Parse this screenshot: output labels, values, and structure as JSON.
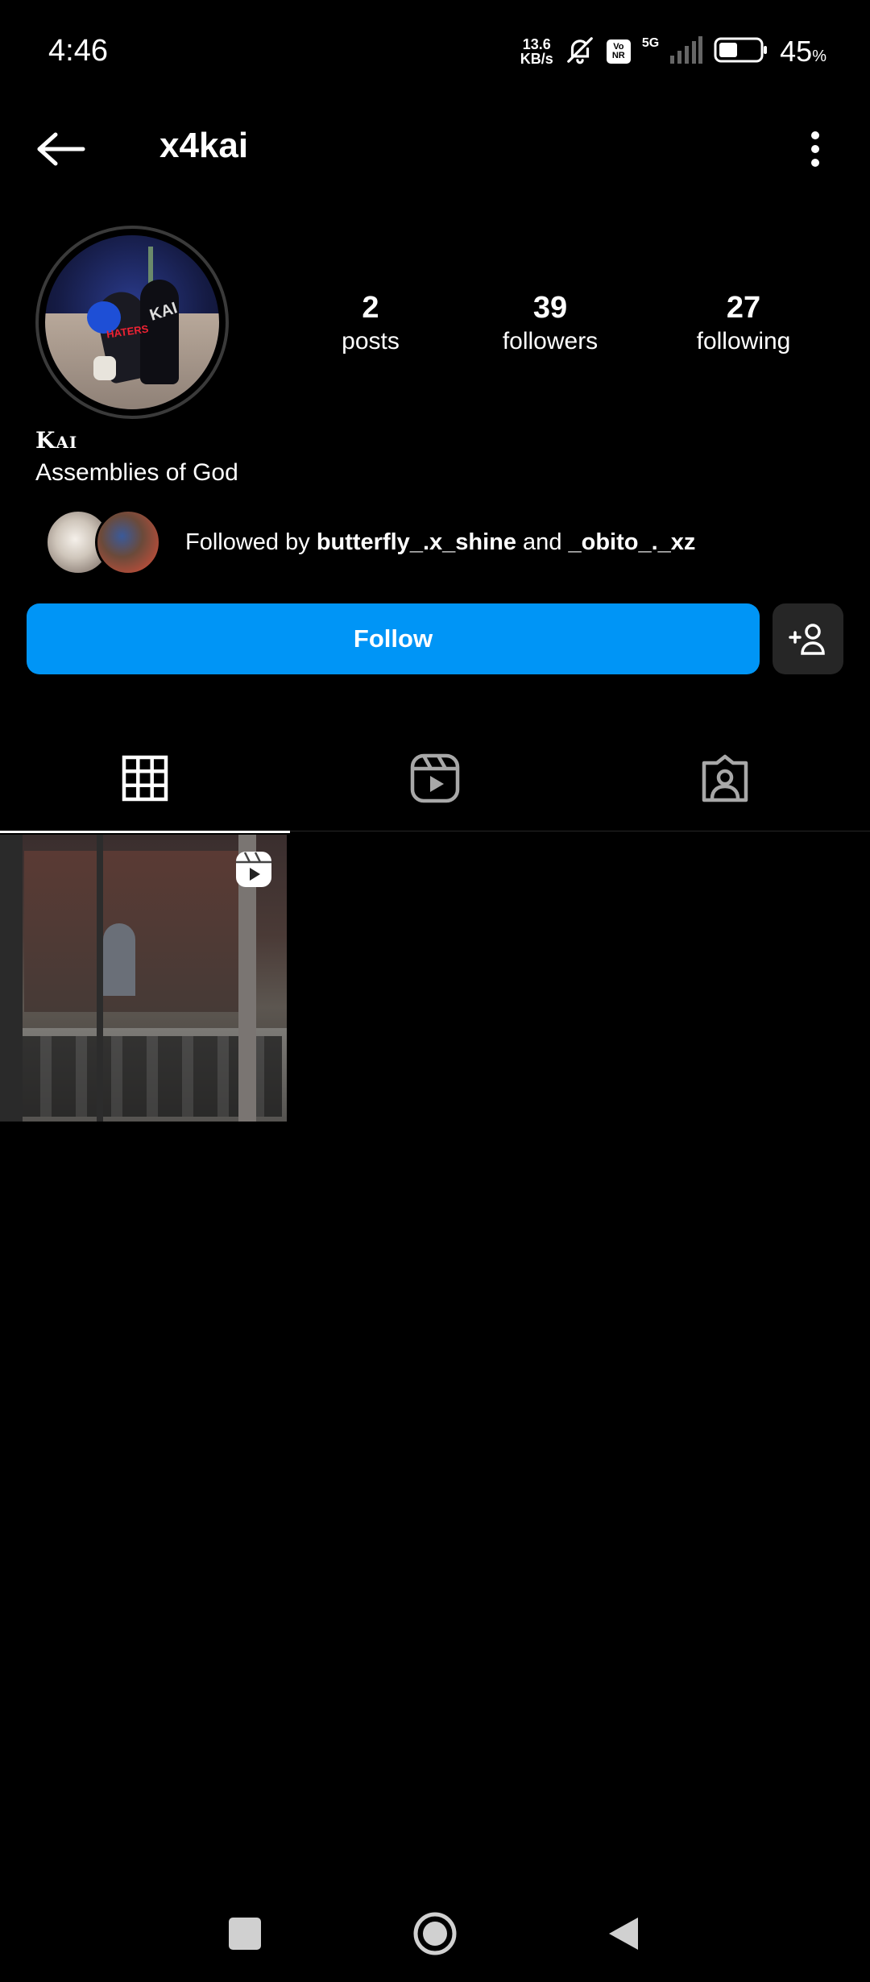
{
  "status_bar": {
    "time": "4:46",
    "net_speed_value": "13.6",
    "net_speed_unit": "KB/s",
    "network": "5G",
    "battery_percent": "45",
    "battery_unit": "%",
    "battery_level": 0.45,
    "icons": [
      "bell-off-icon",
      "volte-icon",
      "signal-icon",
      "battery-icon"
    ]
  },
  "header": {
    "username": "x4kai",
    "back_icon": "arrow-left-icon",
    "more_icon": "more-vertical-icon"
  },
  "profile": {
    "display_name": "Kai",
    "bio": "Assemblies of God",
    "stats": [
      {
        "value": "2",
        "label": "posts"
      },
      {
        "value": "39",
        "label": "followers"
      },
      {
        "value": "27",
        "label": "following"
      }
    ],
    "followed_by": {
      "prefix": "Followed by ",
      "user1": "butterfly_.x_shine",
      "joiner": " and ",
      "user2": "_obito_._xz"
    }
  },
  "actions": {
    "follow_label": "Follow",
    "add_user_icon": "add-user-icon",
    "follow_color": "#0095f6"
  },
  "tabs": [
    {
      "name": "posts",
      "icon": "grid-icon",
      "active": true
    },
    {
      "name": "reels",
      "icon": "reels-icon",
      "active": false
    },
    {
      "name": "tagged",
      "icon": "tagged-icon",
      "active": false
    }
  ],
  "grid": {
    "items": [
      {
        "type": "reel",
        "badge_icon": "reel-badge-icon"
      }
    ]
  },
  "nav": {
    "buttons": [
      "recent-apps-icon",
      "home-icon",
      "back-triangle-icon"
    ]
  }
}
